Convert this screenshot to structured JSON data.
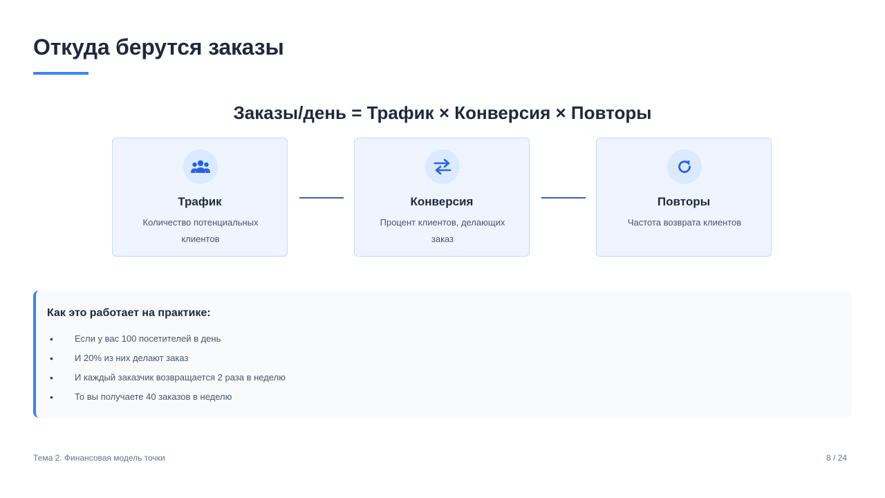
{
  "slide": {
    "title": "Откуда берутся заказы",
    "formula": "Заказы/день = Трафик × Конверсия × Повторы",
    "accent_color": "#3b82f6"
  },
  "cards": [
    {
      "icon": "users-icon",
      "title": "Трафик",
      "description": "Количество потенциальных клиентов"
    },
    {
      "icon": "exchange-arrows-icon",
      "title": "Конверсия",
      "description": "Процент клиентов, делающих заказ"
    },
    {
      "icon": "refresh-icon",
      "title": "Повторы",
      "description": "Частота возврата клиентов"
    }
  ],
  "practice": {
    "heading": "Как это работает на практике:",
    "bullet": "•",
    "items": [
      "Если у вас 100 посетителей в день",
      "И 20% из них делают заказ",
      "И каждый заказчик возвращается 2 раза в неделю",
      "То вы получаете 40 заказов в неделю"
    ]
  },
  "footer": {
    "topic": "Тема 2. Финансовая модель точки",
    "page": "8 / 24"
  }
}
